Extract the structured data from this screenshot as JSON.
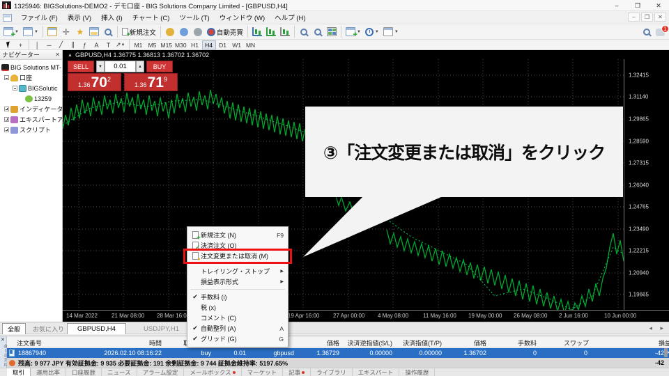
{
  "window": {
    "title": "1325946: BIGSolutions-DEMO2 - デモ口座 - BIG Solutions Company Limited - [GBPUSD,H4]"
  },
  "menu_bar": [
    "ファイル (F)",
    "表示 (V)",
    "挿入 (I)",
    "チャート (C)",
    "ツール (T)",
    "ウィンドウ (W)",
    "ヘルプ (H)"
  ],
  "toolbar": {
    "new_order": "新規注文",
    "autotrading": "自動売買",
    "badge": "1"
  },
  "timeframes": [
    "M1",
    "M5",
    "M15",
    "M30",
    "H1",
    "H4",
    "D1",
    "W1",
    "MN"
  ],
  "tools": {
    "text_a": "A",
    "text_t": "T"
  },
  "navigator": {
    "title": "ナビゲーター",
    "root": "BIG Solutions MT-",
    "accounts": "口座",
    "server": "BIGSolutic",
    "login": "13259",
    "indicators": "インディケータ",
    "experts": "エキスパートアド",
    "scripts": "スクリプト",
    "tab_common": "全般",
    "tab_favorites": "お気に入り"
  },
  "chart": {
    "header": "GBPUSD,H4  1.36775 1.36813 1.36702 1.36702",
    "price_axis": [
      "1.32415",
      "1.31140",
      "1.29865",
      "1.28590",
      "1.27315",
      "1.26040",
      "1.24765",
      "1.23490",
      "1.22215",
      "1.20940",
      "1.19665"
    ],
    "time_axis": [
      "14 Mar 2022",
      "21 Mar 08:00",
      "28 Mar 16:00",
      "19 Apr 16:00",
      "27 Apr 00:00",
      "4 May 08:00",
      "11 May 16:00",
      "19 May 00:00",
      "26 May 08:00",
      "2 Jun 16:00",
      "10 Jun 00:00"
    ],
    "tabs": [
      "GBPUSD,H4",
      "USDJPY,H1"
    ]
  },
  "trade_panel": {
    "sell": "SELL",
    "buy": "BUY",
    "volume": "0.01",
    "sell_price_main": "1.36",
    "sell_price_big": "70",
    "sell_price_sup": "2",
    "buy_price_main": "1.36",
    "buy_price_big": "71",
    "buy_price_sup": "9"
  },
  "callout": {
    "text": "③「注文変更または取消」をクリック"
  },
  "context_menu": {
    "items": [
      {
        "label": "新規注文 (N)",
        "shortcut": "F9"
      },
      {
        "label": "決済注文 (O)",
        "shortcut": ""
      },
      {
        "label": "注文変更または取消 (M)",
        "shortcut": ""
      },
      {
        "label": "トレイリング・ストップ",
        "shortcut": ""
      },
      {
        "label": "損益表示形式",
        "shortcut": ""
      },
      {
        "label": "手数料 (i)",
        "shortcut": ""
      },
      {
        "label": "税 (x)",
        "shortcut": ""
      },
      {
        "label": "コメント (C)",
        "shortcut": ""
      },
      {
        "label": "自動整列 (A)",
        "shortcut": "A"
      },
      {
        "label": "グリッド (G)",
        "shortcut": "G"
      }
    ]
  },
  "terminal": {
    "panel_label": "ターミナル",
    "headers": {
      "order": "注文番号",
      "time": "時間",
      "type": "取",
      "price_open": "価格",
      "sl": "決済逆指値(S/L)",
      "tp": "決済指値(T/P)",
      "price_close": "価格",
      "commission": "手数料",
      "swap": "スワップ",
      "profit": "損益"
    },
    "order_row": {
      "order": "18867940",
      "time": "2026.02.10 08:16:22",
      "type": "buy",
      "volume": "0.01",
      "symbol": "gbpusd",
      "price_open": "1.36729",
      "sl": "0.00000",
      "tp": "0.00000",
      "price_close": "1.36702",
      "commission": "0",
      "swap": "0",
      "profit": "-42"
    },
    "balance_row": {
      "text": "残高: 9 977 JPY  有効証拠金: 9 935  必要証拠金: 191  余剰証拠金: 9 744  証拠金維持率: 5197.65%",
      "profit": "-42"
    },
    "tabs": [
      "取引",
      "運用比率",
      "口座履歴",
      "ニュース",
      "アラーム設定",
      "メールボックス",
      "マーケット",
      "記事",
      "ライブラリ",
      "エキスパート",
      "操作履歴"
    ]
  },
  "icons": {
    "check": "✔",
    "submenu": "▶",
    "dropdown": "▼",
    "spin_up": "▲",
    "collapse": "▲",
    "close": "✕",
    "minimize": "–",
    "restore": "❐",
    "scroll_left": "◂",
    "scroll_right": "▸",
    "vline": "│",
    "hline": "─",
    "trend": "╱",
    "channel": "∥",
    "fibo": "ƒ",
    "arrows": "↗",
    "cross": "+"
  }
}
